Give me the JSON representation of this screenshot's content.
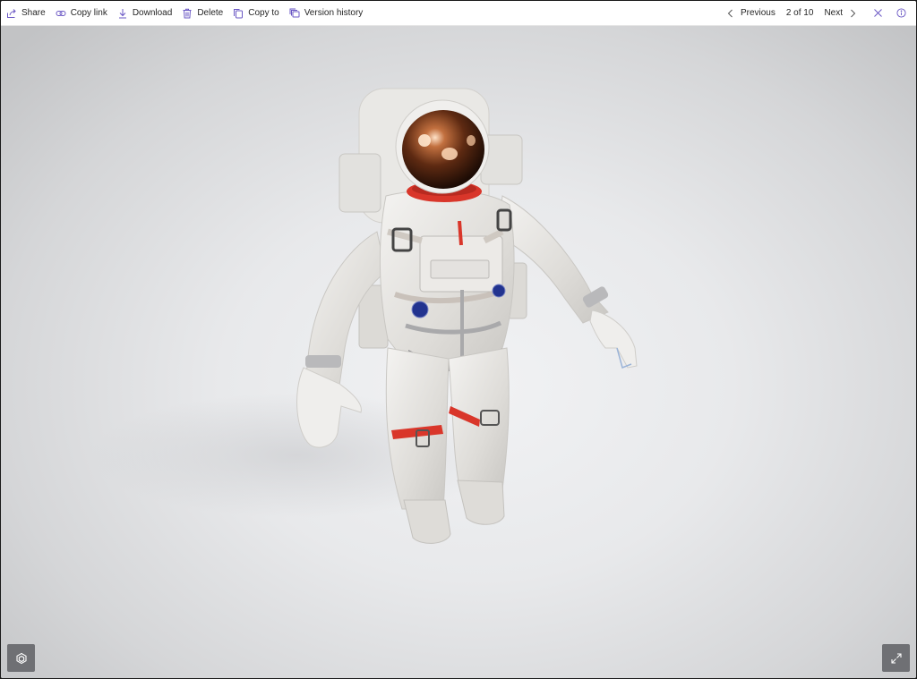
{
  "toolbar": {
    "share_label": "Share",
    "copy_link_label": "Copy link",
    "download_label": "Download",
    "delete_label": "Delete",
    "copy_to_label": "Copy to",
    "version_history_label": "Version history",
    "previous_label": "Previous",
    "counter": "2 of 10",
    "next_label": "Next"
  },
  "icons": {
    "share": "share-icon",
    "copy_link": "link-icon",
    "download": "download-icon",
    "delete": "trash-icon",
    "copy_to": "copy-icon",
    "version_history": "history-icon",
    "previous": "chevron-left-icon",
    "next": "chevron-right-icon",
    "close": "close-icon",
    "info": "info-icon",
    "view_3d": "cube-view-icon",
    "fullscreen": "expand-icon"
  },
  "colors": {
    "accent": "#6a57c4",
    "viewer_bg": "#e6e7e9",
    "corner_button": "#6f7074"
  }
}
